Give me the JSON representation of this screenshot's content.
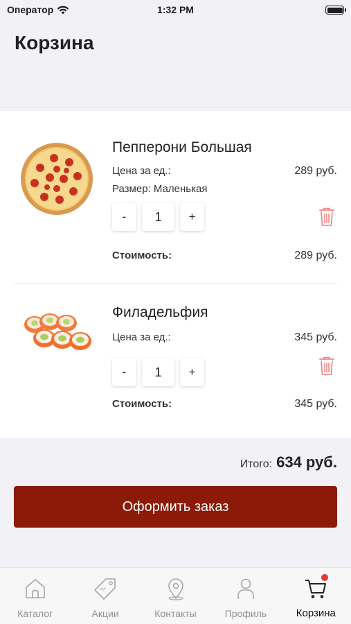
{
  "status_bar": {
    "carrier": "Оператор",
    "time": "1:32 PM"
  },
  "page": {
    "title": "Корзина"
  },
  "cart": {
    "items": [
      {
        "name": "Пепперони Большая",
        "price_label": "Цена за ед.:",
        "price": "289 руб.",
        "size_text": "Размер: Маленькая",
        "quantity": "1",
        "minus": "-",
        "plus": "+",
        "cost_label": "Стоимость:",
        "cost": "289 руб.",
        "image_icon": "pizza-image"
      },
      {
        "name": "Филадельфия",
        "price_label": "Цена за ед.:",
        "price": "345 руб.",
        "quantity": "1",
        "minus": "-",
        "plus": "+",
        "cost_label": "Стоимость:",
        "cost": "345 руб.",
        "image_icon": "sushi-rolls-image"
      }
    ]
  },
  "summary": {
    "total_label": "Итого:",
    "total": "634 руб."
  },
  "checkout": {
    "label": "Оформить заказ"
  },
  "tabbar": {
    "tabs": [
      {
        "label": "Каталог",
        "icon": "home-icon",
        "active": false
      },
      {
        "label": "Акции",
        "icon": "tag-icon",
        "active": false
      },
      {
        "label": "Контакты",
        "icon": "location-pin-icon",
        "active": false
      },
      {
        "label": "Профиль",
        "icon": "person-icon",
        "active": false
      },
      {
        "label": "Корзина",
        "icon": "cart-icon",
        "active": true
      }
    ]
  },
  "colors": {
    "accent": "#8b1a08",
    "trash": "#f08080",
    "badge": "#e53935",
    "background": "#f2f2f6"
  }
}
